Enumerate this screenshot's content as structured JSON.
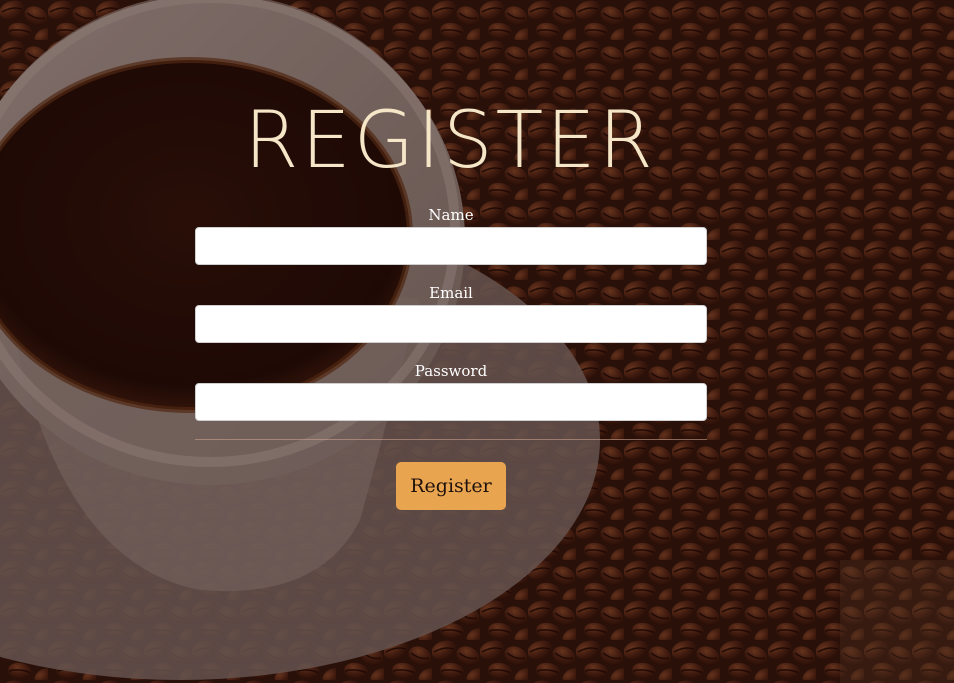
{
  "page": {
    "title": "REGISTER"
  },
  "form": {
    "fields": [
      {
        "label": "Name",
        "value": "",
        "type": "text"
      },
      {
        "label": "Email",
        "value": "",
        "type": "email"
      },
      {
        "label": "Password",
        "value": "",
        "type": "password"
      }
    ],
    "submit_label": "Register"
  },
  "colors": {
    "title": "#f5e6c8",
    "button": "#e9a450",
    "overlay": "#280e08"
  },
  "background": {
    "subject": "coffee-cup-and-beans-photo"
  }
}
